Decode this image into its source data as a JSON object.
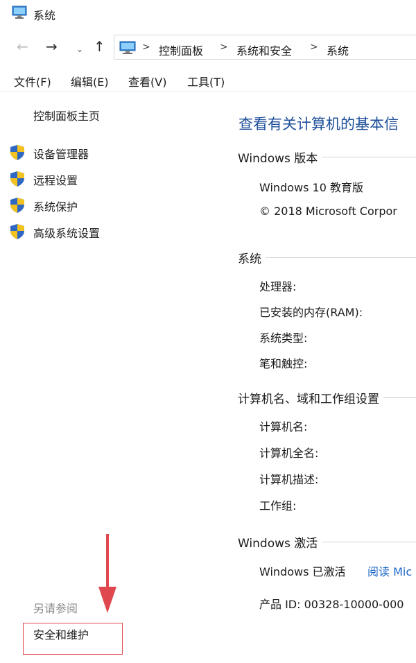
{
  "window": {
    "title": "系统"
  },
  "address": {
    "crumbs": [
      "控制面板",
      "系统和安全",
      "系统"
    ],
    "separator": ">"
  },
  "menu": {
    "items": [
      "文件(F)",
      "编辑(E)",
      "查看(V)",
      "工具(T)"
    ]
  },
  "sidebar": {
    "home": "控制面板主页",
    "tasks": [
      "设备管理器",
      "远程设置",
      "系统保护",
      "高级系统设置"
    ],
    "see_also": "另请参阅",
    "see_also_links": [
      "安全和维护"
    ]
  },
  "main": {
    "heading": "查看有关计算机的基本信",
    "edition_section": {
      "title": "Windows 版本",
      "edition": "Windows 10 教育版",
      "copyright": "© 2018 Microsoft Corpor"
    },
    "system_section": {
      "title": "系统",
      "rows": [
        "处理器:",
        "已安装的内存(RAM):",
        "系统类型:",
        "笔和触控:"
      ]
    },
    "computer_section": {
      "title": "计算机名、域和工作组设置",
      "rows": [
        "计算机名:",
        "计算机全名:",
        "计算机描述:",
        "工作组:"
      ]
    },
    "activation_section": {
      "title": "Windows 激活",
      "status": "Windows 已激活",
      "link": "阅读 Mic",
      "product_id": "产品 ID: 00328-10000-000"
    }
  },
  "colors": {
    "heading": "#1e4f9a",
    "link": "#1a66c7",
    "annotation": "#e0484f",
    "shield_blue": "#2f68c2",
    "shield_yellow": "#f3c221"
  },
  "icons": [
    "computer-icon",
    "back-arrow-icon",
    "forward-arrow-icon",
    "chevron-down-icon",
    "up-arrow-icon",
    "shield-icon"
  ]
}
